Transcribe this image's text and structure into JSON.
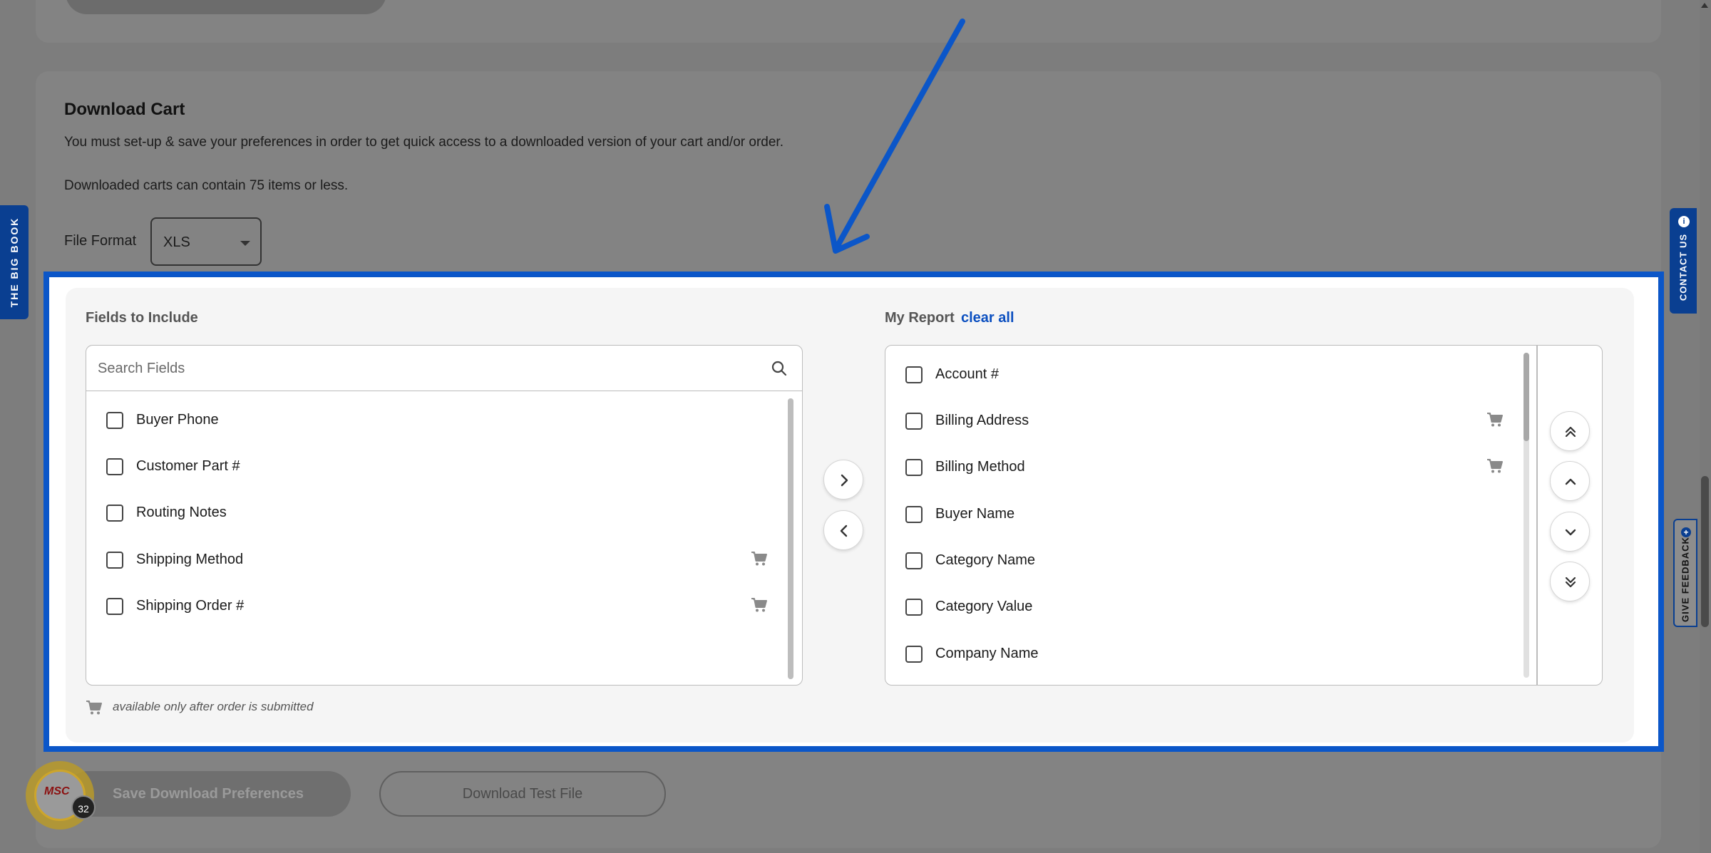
{
  "download_cart": {
    "title": "Download Cart",
    "description": "You must set-up & save your preferences in order to get quick access to a downloaded version of your cart and/or order.",
    "limit_note": "Downloaded carts can contain 75 items or less.",
    "file_format_label": "File Format",
    "file_format_value": "XLS"
  },
  "side_tabs": {
    "big_book": "THE BIG BOOK",
    "contact_us": "CONTACT US",
    "give_feedback": "GIVE FEEDBACK"
  },
  "fields_panel": {
    "title": "Fields to Include",
    "search_placeholder": "Search Fields",
    "items": [
      {
        "label": "Buyer Phone",
        "cart": false
      },
      {
        "label": "Customer Part #",
        "cart": false
      },
      {
        "label": "Routing Notes",
        "cart": false
      },
      {
        "label": "Shipping Method",
        "cart": true
      },
      {
        "label": "Shipping Order #",
        "cart": true
      }
    ]
  },
  "report_panel": {
    "title": "My Report",
    "clear_all": "clear all",
    "items": [
      {
        "label": "Account #",
        "cart": false
      },
      {
        "label": "Billing Address",
        "cart": true
      },
      {
        "label": "Billing Method",
        "cart": true
      },
      {
        "label": "Buyer Name",
        "cart": false
      },
      {
        "label": "Category Name",
        "cart": false
      },
      {
        "label": "Category Value",
        "cart": false
      },
      {
        "label": "Company Name",
        "cart": false
      }
    ]
  },
  "legend_note": "available only after order is submitted",
  "buttons": {
    "save": "Save Download Preferences",
    "test_file": "Download Test File"
  },
  "msc_badge": {
    "logo": "MSC",
    "count": "32"
  },
  "colors": {
    "accent": "#0b56c8",
    "brand_tab": "#0a3f91",
    "link": "#0b4fc0",
    "overlay": "#7d7d7d"
  }
}
